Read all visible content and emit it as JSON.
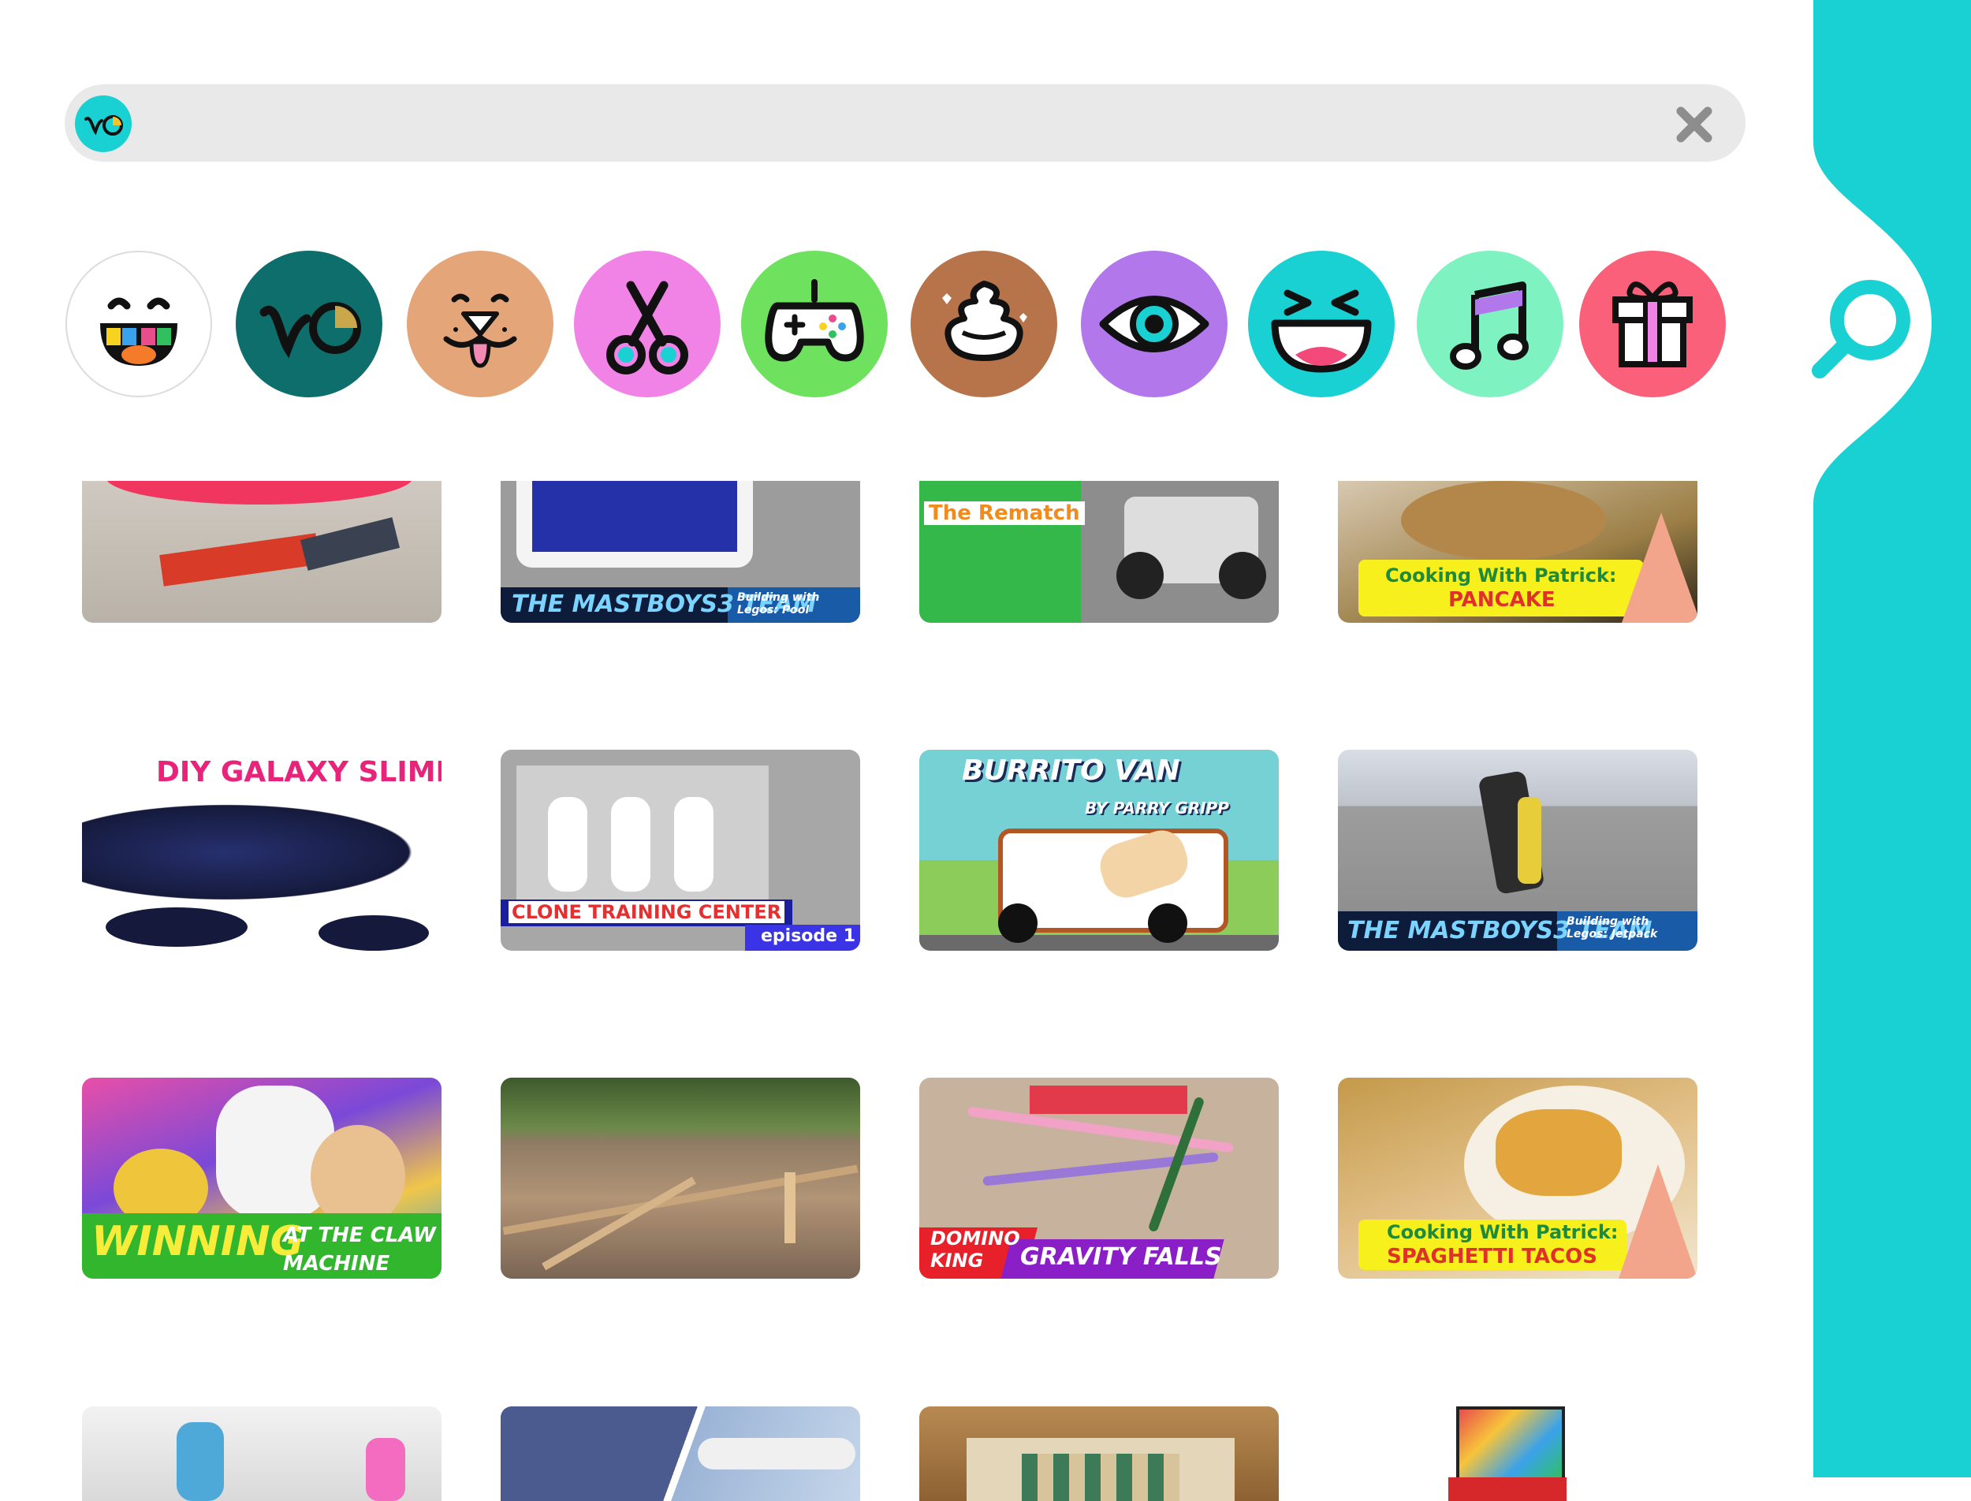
{
  "search": {
    "value": "",
    "placeholder": ""
  },
  "categories": [
    {
      "id": "toca",
      "icon": "toca-face-icon",
      "color": "#ffffff"
    },
    {
      "id": "eyes",
      "icon": "curious-eyes-icon",
      "color": "#0e6e6c"
    },
    {
      "id": "animals",
      "icon": "dog-face-icon",
      "color": "#e4a678"
    },
    {
      "id": "crafts",
      "icon": "scissors-icon",
      "color": "#f283e6"
    },
    {
      "id": "gaming",
      "icon": "gamepad-icon",
      "color": "#6ee15f"
    },
    {
      "id": "gross",
      "icon": "poop-icon",
      "color": "#b7744a"
    },
    {
      "id": "weird",
      "icon": "eye-icon",
      "color": "#b377ec"
    },
    {
      "id": "funny",
      "icon": "laughing-face-icon",
      "color": "#19d1d3"
    },
    {
      "id": "music",
      "icon": "music-note-icon",
      "color": "#7ff2c1"
    },
    {
      "id": "surprise",
      "icon": "gift-icon",
      "color": "#fb607a"
    }
  ],
  "colors": {
    "accent": "#19d1d3",
    "search_bg": "#e9e9e9"
  },
  "videos": [
    {
      "caption": ""
    },
    {
      "caption": "THE MASTBOYS3 TEAM",
      "sub": "Building with Legos: Pool"
    },
    {
      "caption": "The Rematch"
    },
    {
      "caption": "Cooking With Patrick:",
      "sub": "PANCAKE"
    },
    {
      "caption": "DIY GALAXY SLIME"
    },
    {
      "caption": "CLONE TRAINING CENTER",
      "sub": "episode 1"
    },
    {
      "caption": "BURRITO VAN",
      "sub": "BY PARRY GRIPP"
    },
    {
      "caption": "THE MASTBOYS3 TEAM",
      "sub": "Building with Legos: Jetpack"
    },
    {
      "caption": "WINNING",
      "sub": "AT THE CLAW MACHINE"
    },
    {
      "caption": ""
    },
    {
      "caption": "DOMINO KING",
      "sub": "GRAVITY FALLS"
    },
    {
      "caption": "Cooking With Patrick:",
      "sub": "SPAGHETTI TACOS"
    },
    {
      "caption": ""
    },
    {
      "caption": ""
    },
    {
      "caption": ""
    },
    {
      "caption": ""
    }
  ]
}
